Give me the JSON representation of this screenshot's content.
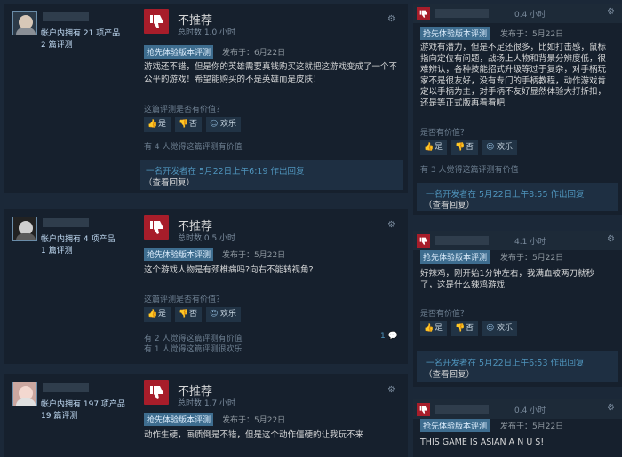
{
  "icons": {
    "thumb_down": "thumb-down-icon",
    "gear": "gear-icon",
    "thumb_up_small": "thumb-up-icon",
    "comment": "comment-icon"
  },
  "colors": {
    "not_recommended": "#a71d2a",
    "badge": "#3e6d8f",
    "link": "#4f94bc",
    "bg": "#1b2838"
  },
  "left_reviews": [
    {
      "owned": "帐户内拥有 21 项产品",
      "reviews_count": "2 篇评测",
      "verdict": "不推荐",
      "hours": "总时数 1.0 小时",
      "badge": "抢先体验版本评测",
      "posted": "发布于：6月22日",
      "content_lines": [
        "游戏还不错，但是你的英雄需要真钱购买这就把这游戏变成了一个不",
        "公平的游戏！希望能购买的不是英雄而是皮肤！"
      ],
      "helpful_q": "这篇评测是否有价值？",
      "btn_yes": "是",
      "btn_no": "否",
      "btn_funny": "欢乐",
      "found1": "有 4 人觉得这篇评测有价值",
      "dev_reply": "一名开发者在 5月22日上午6:19 作出回复",
      "view_reply": "（查看回复）"
    },
    {
      "owned": "帐户内拥有 4 项产品",
      "reviews_count": "1 篇评测",
      "verdict": "不推荐",
      "hours": "总时数 0.5 小时",
      "badge": "抢先体验版本评测",
      "posted": "发布于：5月22日",
      "content_lines": [
        "这个游戏人物是有颈椎病吗?向右不能转视角?"
      ],
      "helpful_q": "这篇评测是否有价值？",
      "btn_yes": "是",
      "btn_no": "否",
      "btn_funny": "欢乐",
      "found1": "有 2 人觉得这篇评测有价值",
      "found2": "有 1 人觉得这篇评测很欢乐",
      "comments": "1"
    },
    {
      "owned": "帐户内拥有 197 项产品",
      "reviews_count": "19 篇评测",
      "verdict": "不推荐",
      "hours": "总时数 1.7 小时",
      "badge": "抢先体验版本评测",
      "posted": "发布于：5月22日",
      "content_lines": [
        "动作生硬，画质倒是不错，但是这个动作僵硬的让我玩不来"
      ]
    }
  ],
  "right_reviews": [
    {
      "hours": "0.4 小时",
      "badge": "抢先体验版本评测",
      "posted": "发布于：5月22日",
      "content_lines": [
        "游戏有潜力，但是不足还很多，比如打击感，鼠标",
        "指向定位有问题，战场上人物和背景分辨度低，很",
        "难辨认，各种技能招式升级等过于复杂，对手柄玩",
        "家不是很友好，没有专门的手柄教程，动作游戏肯",
        "定以手柄为主，对手柄不友好显然体验大打折扣，",
        "还是等正式版再看看吧"
      ],
      "helpful_q": "是否有价值？",
      "btn_yes": "是",
      "btn_no": "否",
      "btn_funny": "欢乐",
      "found1": "有 3 人觉得这篇评测有价值",
      "dev_reply": "一名开发者在 5月22日上午8:55 作出回复",
      "view_reply": "（查看回复）"
    },
    {
      "hours": "4.1 小时",
      "badge": "抢先体验版本评测",
      "posted": "发布于：5月22日",
      "content_lines": [
        "好辣鸡，刚开始1分钟左右，我满血被两刀就秒",
        "了，这是什么辣鸡游戏"
      ],
      "helpful_q": "是否有价值？",
      "btn_yes": "是",
      "btn_no": "否",
      "btn_funny": "欢乐",
      "dev_reply": "一名开发者在 5月22日上午6:53 作出回复",
      "view_reply": "（查看回复）"
    },
    {
      "hours": "0.4 小时",
      "badge": "抢先体验版本评测",
      "posted": "发布于：5月22日",
      "content_lines": [
        "THIS GAME IS ASIAN A N U S!"
      ]
    }
  ]
}
